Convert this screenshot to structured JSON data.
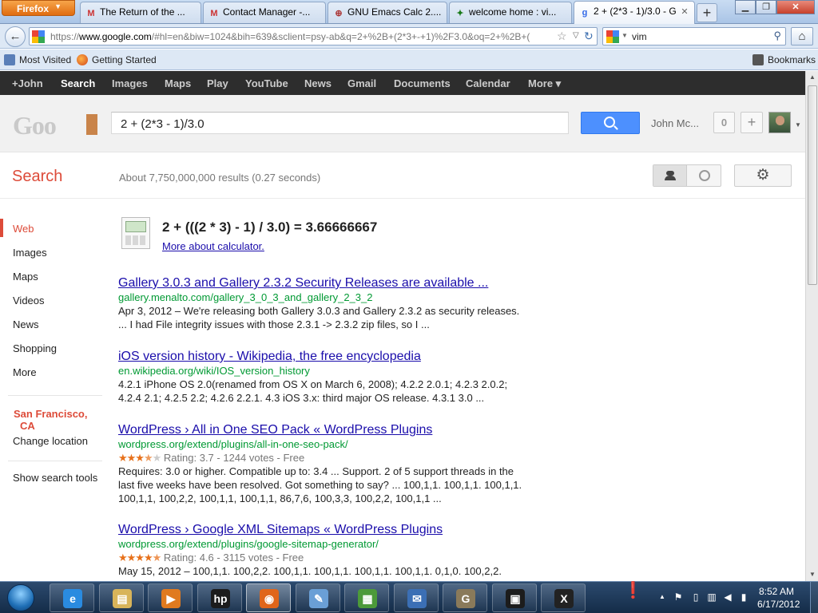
{
  "browser": {
    "menu_label": "Firefox",
    "tabs": [
      {
        "label": "The Return of the ...",
        "icon": "gmail-icon"
      },
      {
        "label": "Contact Manager -...",
        "icon": "gmail-icon"
      },
      {
        "label": "GNU Emacs Calc 2....",
        "icon": "gnu-icon"
      },
      {
        "label": "welcome home : vi...",
        "icon": "vim-icon"
      },
      {
        "label": "2 + (2*3 - 1)/3.0 - G...",
        "icon": "google-icon",
        "active": true
      }
    ],
    "url_scheme": "https://",
    "url_domain": "www.google.com",
    "url_rest": "/#hl=en&biw=1024&bih=639&sclient=psy-ab&q=2+%2B+(2*3+-+1)%2F3.0&oq=2+%2B+(",
    "search_box_value": "vim",
    "bookmarks": {
      "most_visited": "Most Visited",
      "getting_started": "Getting Started",
      "bookmarks": "Bookmarks"
    }
  },
  "gbar": [
    "+John",
    "Search",
    "Images",
    "Maps",
    "Play",
    "YouTube",
    "News",
    "Gmail",
    "Documents",
    "Calendar",
    "More ▾"
  ],
  "header": {
    "query": "2 + (2*3 - 1)/3.0",
    "user_name": "John Mc...",
    "notification_count": "0",
    "share_label": "+"
  },
  "results_header": {
    "section_label": "Search",
    "stats": "About 7,750,000,000 results (0.27 seconds)"
  },
  "left_nav": {
    "items": [
      "Web",
      "Images",
      "Maps",
      "Videos",
      "News",
      "Shopping",
      "More"
    ],
    "location_line1": "San Francisco,",
    "location_line2": "CA",
    "change_location": "Change location",
    "search_tools": "Show search tools"
  },
  "calculator": {
    "result": "2 + (((2 * 3) - 1) / 3.0) = 3.66666667",
    "more_link": "More about calculator."
  },
  "results": [
    {
      "title": "Gallery 3.0.3 and Gallery 2.3.2 Security Releases are available ...",
      "url": "gallery.menalto.com/gallery_3_0_3_and_gallery_2_3_2",
      "snippet_line1": "Apr 3, 2012 – We're releasing both Gallery 3.0.3 and Gallery 2.3.2 as security releases.",
      "snippet_line2": "... I had File integrity issues with those 2.3.1 -> 2.3.2 zip files, so I ..."
    },
    {
      "title": "iOS version history - Wikipedia, the free encyclopedia",
      "url": "en.wikipedia.org/wiki/IOS_version_history",
      "snippet_line1": "4.2.1 iPhone OS 2.0(renamed from OS X on March 6, 2008); 4.2.2 2.0.1; 4.2.3 2.0.2;",
      "snippet_line2": "4.2.4 2.1; 4.2.5 2.2; 4.2.6 2.2.1. 4.3 iOS 3.x: third major OS release. 4.3.1 3.0 ..."
    },
    {
      "title": "WordPress › All in One SEO Pack « WordPress Plugins",
      "url": "wordpress.org/extend/plugins/all-in-one-seo-pack/",
      "rating_text": "Rating: 3.7 - 1244 votes - Free",
      "rating_value": 3.7,
      "snippet_line1": "Requires: 3.0 or higher. Compatible up to: 3.4 ... Support. 2 of 5 support threads in the",
      "snippet_line2": "last five weeks have been resolved. Got something to say? ... 100,1,1. 100,1,1. 100,1,1.",
      "snippet_line3": "100,1,1, 100,2,2, 100,1,1, 100,1,1, 86,7,6, 100,3,3, 100,2,2, 100,1,1 ..."
    },
    {
      "title": "WordPress › Google XML Sitemaps « WordPress Plugins",
      "url": "wordpress.org/extend/plugins/google-sitemap-generator/",
      "rating_text": "Rating: 4.6 - 3115 votes - Free",
      "rating_value": 4.6,
      "snippet_line1": "May 15, 2012 – 100,1,1. 100,2,2. 100,1,1. 100,1,1. 100,1,1. 100,1,1. 0,1,0. 100,2,2."
    }
  ],
  "taskbar": {
    "apps": [
      {
        "name": "internet-explorer",
        "glyph": "e",
        "color": "#2a8be0"
      },
      {
        "name": "file-explorer",
        "glyph": "▤",
        "color": "#d8b45a"
      },
      {
        "name": "media-player",
        "glyph": "▶",
        "color": "#e07a1f"
      },
      {
        "name": "hp-app",
        "glyph": "hp",
        "color": "#1c1c1c"
      },
      {
        "name": "firefox",
        "glyph": "◉",
        "color": "#e0651a",
        "active": true
      },
      {
        "name": "notepad",
        "glyph": "✎",
        "color": "#6a9fd6"
      },
      {
        "name": "chart-app",
        "glyph": "▦",
        "color": "#4c9a3a"
      },
      {
        "name": "thunderbird",
        "glyph": "✉",
        "color": "#3b6fb5"
      },
      {
        "name": "gimp",
        "glyph": "G",
        "color": "#8a7a5a"
      },
      {
        "name": "terminal",
        "glyph": "▣",
        "color": "#1c1c1c"
      },
      {
        "name": "x-window",
        "glyph": "X",
        "color": "#222"
      }
    ],
    "clock_time": "8:52 AM",
    "clock_date": "6/17/2012"
  }
}
